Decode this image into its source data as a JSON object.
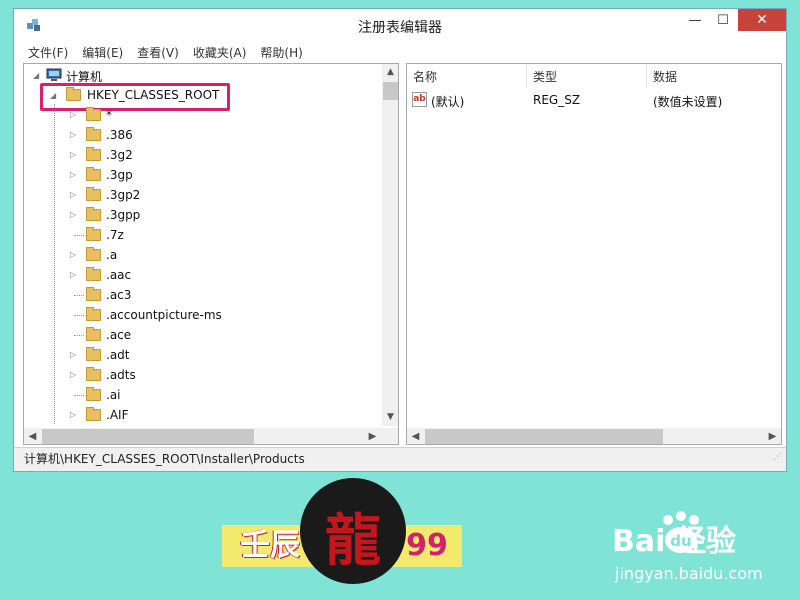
{
  "window": {
    "title": "注册表编辑器",
    "min_glyph": "—",
    "max_glyph": "☐",
    "close_glyph": "✕"
  },
  "menu": [
    "文件(F)",
    "编辑(E)",
    "查看(V)",
    "收藏夹(A)",
    "帮助(H)"
  ],
  "tree": {
    "root": "计算机",
    "selected": "HKEY_CLASSES_ROOT",
    "children": [
      {
        "label": "*",
        "expandable": true
      },
      {
        "label": ".386",
        "expandable": true
      },
      {
        "label": ".3g2",
        "expandable": true
      },
      {
        "label": ".3gp",
        "expandable": true
      },
      {
        "label": ".3gp2",
        "expandable": true
      },
      {
        "label": ".3gpp",
        "expandable": true
      },
      {
        "label": ".7z",
        "expandable": false
      },
      {
        "label": ".a",
        "expandable": true
      },
      {
        "label": ".aac",
        "expandable": true
      },
      {
        "label": ".ac3",
        "expandable": false
      },
      {
        "label": ".accountpicture-ms",
        "expandable": false
      },
      {
        "label": ".ace",
        "expandable": false
      },
      {
        "label": ".adt",
        "expandable": true
      },
      {
        "label": ".adts",
        "expandable": true
      },
      {
        "label": ".ai",
        "expandable": false
      },
      {
        "label": ".AIF",
        "expandable": true
      }
    ]
  },
  "list": {
    "columns": [
      "名称",
      "类型",
      "数据"
    ],
    "rows": [
      {
        "name": "(默认)",
        "type": "REG_SZ",
        "data": "(数值未设置)"
      }
    ]
  },
  "status": {
    "path": "计算机\\HKEY_CLASSES_ROOT\\Installer\\Products"
  },
  "banner": {
    "left_text": "壬辰",
    "right_text": "99",
    "logo_mark": "龍"
  },
  "watermark": {
    "logo_text": "Bai  经验",
    "paw_text": "du",
    "url": "jingyan.baidu.com"
  },
  "icons": {
    "app": "registry-editor-icon",
    "computer": "computer-icon",
    "folder": "folder-icon",
    "value": "string-value-icon"
  },
  "colors": {
    "background": "#7fe3d6",
    "close_button": "#c8433a",
    "highlight": "#d4216d",
    "folder": "#e8c060"
  }
}
